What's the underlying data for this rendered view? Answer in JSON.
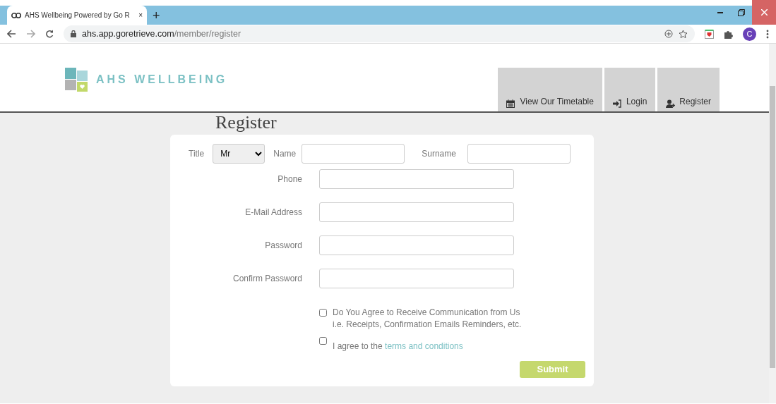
{
  "browser": {
    "tab": {
      "title": "AHS Wellbeing Powered by Go R",
      "close": "×"
    },
    "new_tab": "+",
    "url": {
      "domain": "ahs.app.goretrieve.com",
      "path": "/member/register"
    },
    "profile_initial": "C"
  },
  "site": {
    "logo_text": "AHS WELLBEING",
    "nav": [
      {
        "label": "View Our Timetable"
      },
      {
        "label": "Login"
      },
      {
        "label": "Register"
      }
    ]
  },
  "form": {
    "heading": "Register",
    "title_label": "Title",
    "title_value": "Mr",
    "name_label": "Name",
    "surname_label": "Surname",
    "fields": [
      {
        "label": "Phone"
      },
      {
        "label": "E-Mail Address"
      },
      {
        "label": "Password"
      },
      {
        "label": "Confirm Password"
      }
    ],
    "checkboxes": [
      {
        "lines": [
          "Do You Agree to Receive Communication from Us",
          "i.e. Receipts, Confirmation Emails Reminders, etc."
        ],
        "checked": false
      },
      {
        "text": "I agree to the ",
        "link": "terms and conditions",
        "checked": false
      }
    ],
    "submit": "Submit"
  }
}
